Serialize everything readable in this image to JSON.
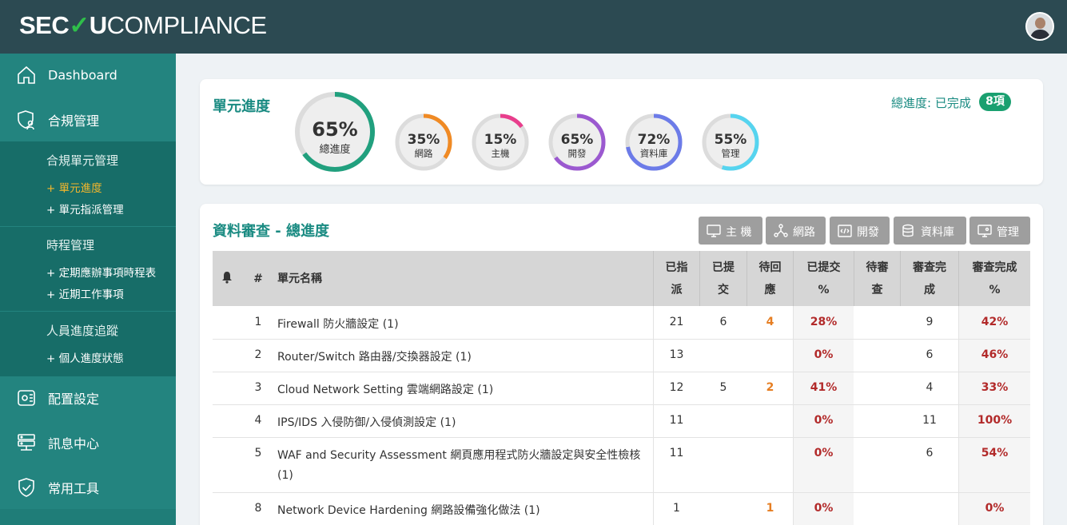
{
  "header": {
    "logo": {
      "part1": "SEC",
      "check": "✓",
      "part2": "U",
      "part3": "COMPLIANCE"
    }
  },
  "sidebar": {
    "dashboard": "Dashboard",
    "compliance": "合規管理",
    "compliance_unit_mgmt": "合規單元管理",
    "unit_progress": "+ 單元進度",
    "unit_assign": "+ 單元指派管理",
    "schedule_mgmt": "時程管理",
    "periodic_schedule": "+ 定期應辦事項時程表",
    "recent_work": "+ 近期工作事項",
    "personnel_tracking": "人員進度追蹤",
    "personal_status": "+ 個人進度狀態",
    "config": "配置設定",
    "messages": "訊息中心",
    "tools": "常用工具"
  },
  "progress": {
    "title": "單元進度",
    "total_label": "總進度: 已完成",
    "total_badge": "8項",
    "rings": [
      {
        "pct": "65%",
        "label": "總進度",
        "value": 65,
        "color": "#21a07e"
      },
      {
        "pct": "35%",
        "label": "網路",
        "value": 35,
        "color": "#f08a24"
      },
      {
        "pct": "15%",
        "label": "主機",
        "value": 15,
        "color": "#e83e8c"
      },
      {
        "pct": "65%",
        "label": "開發",
        "value": 65,
        "color": "#9b59d0"
      },
      {
        "pct": "72%",
        "label": "資料庫",
        "value": 72,
        "color": "#6c7be8"
      },
      {
        "pct": "55%",
        "label": "管理",
        "value": 55,
        "color": "#56d4ef"
      }
    ]
  },
  "review": {
    "title": "資料審查 - 總進度",
    "filters": [
      "主 機",
      "網路",
      "開發",
      "資料庫",
      "管理"
    ],
    "columns": {
      "num": "#",
      "name": "單元名稱",
      "assigned": [
        "已指",
        "派"
      ],
      "submitted": [
        "已提",
        "交"
      ],
      "pending": [
        "待回",
        "應"
      ],
      "submitted_pct": [
        "已提交",
        "%"
      ],
      "to_review": [
        "待審",
        "查"
      ],
      "reviewed": [
        "審查完",
        "成"
      ],
      "reviewed_pct": [
        "審查完成",
        "%"
      ]
    },
    "rows": [
      {
        "num": "1",
        "name": "Firewall 防火牆設定 (1)",
        "name2": "",
        "assigned": "21",
        "submitted": "6",
        "pending": "4",
        "submitted_pct": "28%",
        "to_review": "",
        "reviewed": "9",
        "reviewed_pct": "42%"
      },
      {
        "num": "2",
        "name": "Router/Switch 路由器/交換器設定 (1)",
        "name2": "",
        "assigned": "13",
        "submitted": "",
        "pending": "",
        "submitted_pct": "0%",
        "to_review": "",
        "reviewed": "6",
        "reviewed_pct": "46%"
      },
      {
        "num": "3",
        "name": "Cloud Network Setting 雲端網路設定 (1)",
        "name2": "",
        "assigned": "12",
        "submitted": "5",
        "pending": "2",
        "submitted_pct": "41%",
        "to_review": "",
        "reviewed": "4",
        "reviewed_pct": "33%"
      },
      {
        "num": "4",
        "name": "IPS/IDS 入侵防御/入侵偵測設定 (1)",
        "name2": "",
        "assigned": "11",
        "submitted": "",
        "pending": "",
        "submitted_pct": "0%",
        "to_review": "",
        "reviewed": "11",
        "reviewed_pct": "100%"
      },
      {
        "num": "5",
        "name": "WAF and Security Assessment 網頁應用程式防火牆設定與安全性檢核",
        "name2": "(1)",
        "assigned": "11",
        "submitted": "",
        "pending": "",
        "submitted_pct": "0%",
        "to_review": "",
        "reviewed": "6",
        "reviewed_pct": "54%"
      },
      {
        "num": "8",
        "name": "Network Device Hardening 網路設備強化做法 (1)",
        "name2": "",
        "assigned": "1",
        "submitted": "",
        "pending": "1",
        "submitted_pct": "0%",
        "to_review": "",
        "reviewed": "",
        "reviewed_pct": "0%"
      }
    ]
  }
}
